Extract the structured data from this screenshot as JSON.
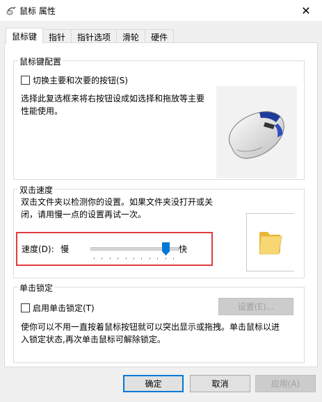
{
  "window": {
    "title": "鼠标 属性",
    "close_glyph": "✕"
  },
  "tabs": [
    "鼠标键",
    "指针",
    "指针选项",
    "滑轮",
    "硬件"
  ],
  "button_config": {
    "group_title": "鼠标键配置",
    "swap_label": "切换主要和次要的按钮(S)",
    "swap_checked": false,
    "description_line1": "选择此复选框来将右按钮设成如选择和拖放等主要",
    "description_line2": "性能使用。"
  },
  "double_click": {
    "group_title": "双击速度",
    "description_line1": "双击文件夹以检测你的设置。如果文件夹没打开或关",
    "description_line2": "闭，请用慢一点的设置再试一次。",
    "speed_label": "速度(D):",
    "slow_label": "慢",
    "fast_label": "快",
    "speed_level": 0.9
  },
  "click_lock": {
    "group_title": "单击锁定",
    "enable_label": "启用单击锁定(T)",
    "enable_checked": false,
    "settings_button": "设置(E)...",
    "description_line1": "使你可以不用一直按着鼠标按钮就可以突出显示或拖拽。单击鼠标以进",
    "description_line2": "入锁定状态,再次单击鼠标可解除锁定。"
  },
  "footer": {
    "ok": "确定",
    "cancel": "取消",
    "apply": "应用(A)"
  },
  "colors": {
    "highlight_box": "#e03c3c",
    "accent": "#0078d7",
    "folder": "#f5c542"
  }
}
